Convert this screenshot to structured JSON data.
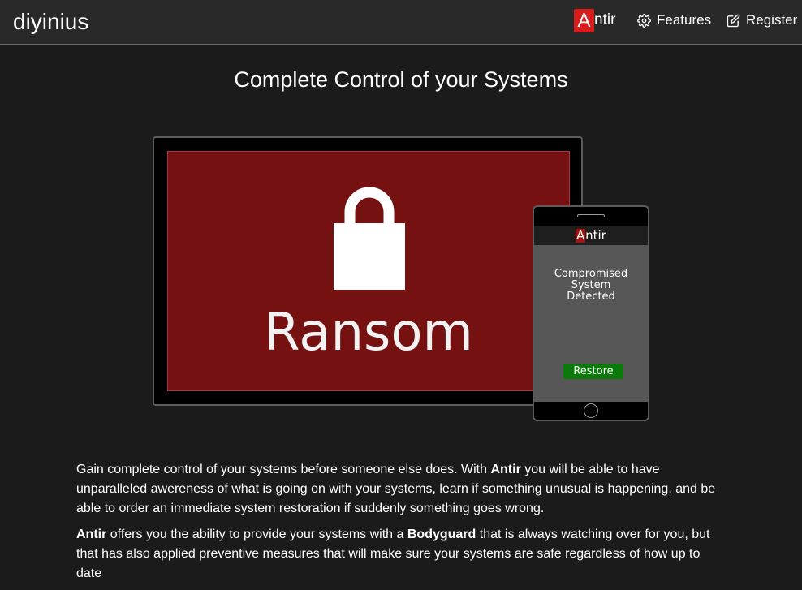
{
  "nav": {
    "brand": "diyinius",
    "antir_logo_letter": "A",
    "antir_rest": "ntir",
    "features_label": "Features",
    "register_label": "Register",
    "features_icon": "gear-icon",
    "register_icon": "edit-icon"
  },
  "hero": {
    "title": "Complete Control of your Systems",
    "tablet": {
      "lock_icon": "padlock-icon",
      "screen_text": "Ransom"
    },
    "phone": {
      "header_logo_letter": "A",
      "header_rest": "ntir",
      "message_line1": "Compromised",
      "message_line2": "System",
      "message_line3": "Detected",
      "restore_label": "Restore"
    }
  },
  "content": {
    "p1_a": "Gain complete control of your systems before someone else does. With ",
    "p1_bold": "Antir",
    "p1_b": " you will be able to have unparalleled awereness of what is going on with your systems, learn if something unusual is happening, and be able to order an immediate system restoration if suddenly something goes wrong.",
    "p2_bold1": "Antir",
    "p2_a": " offers you the ability to provide your systems with a ",
    "p2_bold2": "Bodyguard",
    "p2_b": " that is always watching over for you, but that has also applied preventive measures that will make sure your systems are safe regardless of how up to date"
  },
  "colors": {
    "background": "#1b1b1b",
    "navbar": "#292929",
    "brand_red": "#d81c1c",
    "ransom_screen": "#761111",
    "restore_green": "#0b7a0b",
    "phone_screen": "#575757"
  }
}
